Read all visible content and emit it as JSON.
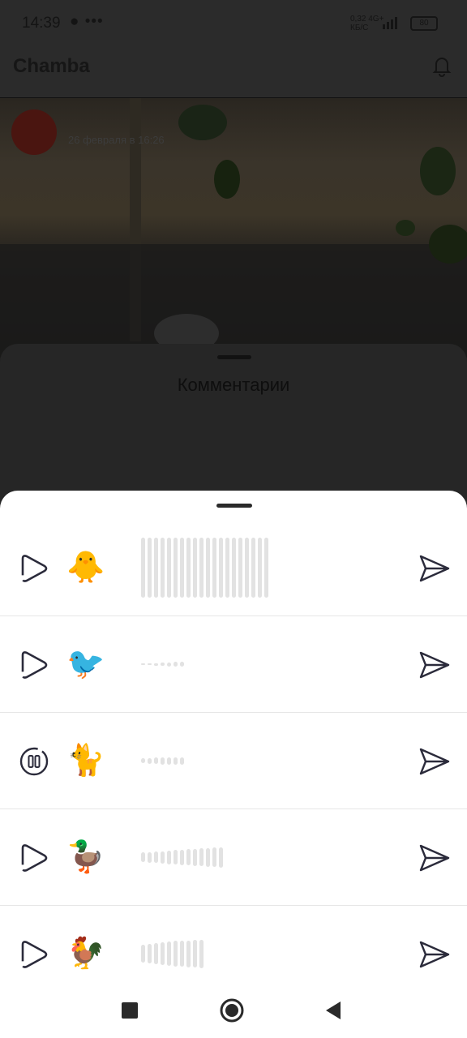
{
  "status": {
    "time": "14:39",
    "dots": "● •••",
    "net_top": "0,32 4G+",
    "net_bottom": "КБ/С",
    "battery": "80"
  },
  "app": {
    "title": "Chamba"
  },
  "post": {
    "date": "26 февраля в 16:26"
  },
  "comments": {
    "title": "Комментарии"
  },
  "voice_rows": [
    {
      "emoji": "🐥",
      "state": "play",
      "bars": [
        74,
        74,
        74,
        74,
        74,
        74,
        74,
        74,
        74,
        74,
        74,
        74,
        74,
        74,
        74,
        74,
        74,
        74,
        74,
        74
      ]
    },
    {
      "emoji": "🐦",
      "state": "play",
      "bars": [
        2,
        2,
        3,
        4,
        5,
        6,
        6
      ]
    },
    {
      "emoji": "🐈",
      "state": "pause",
      "bars": [
        6,
        7,
        8,
        9,
        9,
        9,
        9
      ]
    },
    {
      "emoji": "🦆",
      "state": "play",
      "bars": [
        12,
        13,
        14,
        15,
        17,
        18,
        19,
        20,
        21,
        22,
        23,
        24,
        25
      ]
    },
    {
      "emoji": "🐓",
      "state": "play",
      "bars": [
        22,
        24,
        26,
        28,
        30,
        32,
        32,
        33,
        34,
        35
      ]
    }
  ],
  "colors": {
    "overlay": "#1e1e1e",
    "sheet": "#ffffff",
    "icon": "#2b2b3b",
    "wave": "#e2e2e2"
  },
  "icons": {
    "play": "play-triangle-icon",
    "pause": "pause-circle-icon",
    "send": "send-icon",
    "bell": "bell-icon"
  }
}
